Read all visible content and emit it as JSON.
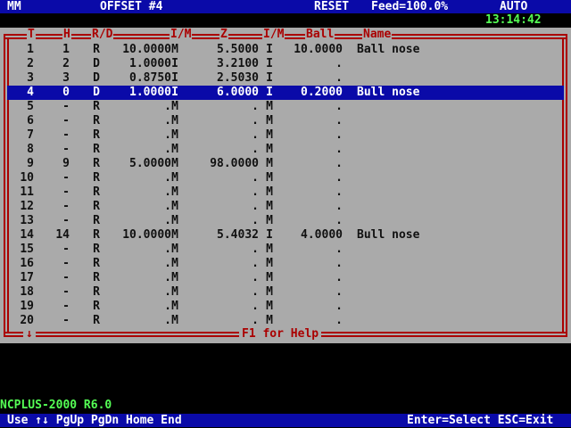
{
  "topbar": {
    "units": "MM",
    "title": "OFFSET #4",
    "state": "RESET",
    "feed": "Feed=100.0%",
    "mode": "AUTO"
  },
  "clock": "13:14:42",
  "table": {
    "headers": {
      "t": "T",
      "h": "H",
      "rd": "R/D",
      "im1": "I/M",
      "z": "Z",
      "im2": "I/M",
      "ball": "Ball",
      "name": "Name"
    },
    "scroll_arrow": "↓",
    "help_label": "F1 for Help",
    "rows": [
      {
        "t": "1",
        "h": "1",
        "rd": "R",
        "dia": "10.0000",
        "im1": "M",
        "z": "5.5000",
        "im2": "I",
        "ball": "10.0000",
        "name": "Ball nose"
      },
      {
        "t": "2",
        "h": "2",
        "rd": "D",
        "dia": "1.0000",
        "im1": "I",
        "z": "3.2100",
        "im2": "I",
        "ball": ".",
        "name": ""
      },
      {
        "t": "3",
        "h": "3",
        "rd": "D",
        "dia": "0.8750",
        "im1": "I",
        "z": "2.5030",
        "im2": "I",
        "ball": ".",
        "name": ""
      },
      {
        "t": "4",
        "h": "0",
        "rd": "D",
        "dia": "1.0000",
        "im1": "I",
        "z": "6.0000",
        "im2": "I",
        "ball": "0.2000",
        "name": "Bull nose"
      },
      {
        "t": "5",
        "h": "-",
        "rd": "R",
        "dia": ".",
        "im1": "M",
        "z": ".",
        "im2": "M",
        "ball": ".",
        "name": ""
      },
      {
        "t": "6",
        "h": "-",
        "rd": "R",
        "dia": ".",
        "im1": "M",
        "z": ".",
        "im2": "M",
        "ball": ".",
        "name": ""
      },
      {
        "t": "7",
        "h": "-",
        "rd": "R",
        "dia": ".",
        "im1": "M",
        "z": ".",
        "im2": "M",
        "ball": ".",
        "name": ""
      },
      {
        "t": "8",
        "h": "-",
        "rd": "R",
        "dia": ".",
        "im1": "M",
        "z": ".",
        "im2": "M",
        "ball": ".",
        "name": ""
      },
      {
        "t": "9",
        "h": "9",
        "rd": "R",
        "dia": "5.0000",
        "im1": "M",
        "z": "98.0000",
        "im2": "M",
        "ball": ".",
        "name": ""
      },
      {
        "t": "10",
        "h": "-",
        "rd": "R",
        "dia": ".",
        "im1": "M",
        "z": ".",
        "im2": "M",
        "ball": ".",
        "name": ""
      },
      {
        "t": "11",
        "h": "-",
        "rd": "R",
        "dia": ".",
        "im1": "M",
        "z": ".",
        "im2": "M",
        "ball": ".",
        "name": ""
      },
      {
        "t": "12",
        "h": "-",
        "rd": "R",
        "dia": ".",
        "im1": "M",
        "z": ".",
        "im2": "M",
        "ball": ".",
        "name": ""
      },
      {
        "t": "13",
        "h": "-",
        "rd": "R",
        "dia": ".",
        "im1": "M",
        "z": ".",
        "im2": "M",
        "ball": ".",
        "name": ""
      },
      {
        "t": "14",
        "h": "14",
        "rd": "R",
        "dia": "10.0000",
        "im1": "M",
        "z": "5.4032",
        "im2": "I",
        "ball": "4.0000",
        "name": "Bull nose"
      },
      {
        "t": "15",
        "h": "-",
        "rd": "R",
        "dia": ".",
        "im1": "M",
        "z": ".",
        "im2": "M",
        "ball": ".",
        "name": ""
      },
      {
        "t": "16",
        "h": "-",
        "rd": "R",
        "dia": ".",
        "im1": "M",
        "z": ".",
        "im2": "M",
        "ball": ".",
        "name": ""
      },
      {
        "t": "17",
        "h": "-",
        "rd": "R",
        "dia": ".",
        "im1": "M",
        "z": ".",
        "im2": "M",
        "ball": ".",
        "name": ""
      },
      {
        "t": "18",
        "h": "-",
        "rd": "R",
        "dia": ".",
        "im1": "M",
        "z": ".",
        "im2": "M",
        "ball": ".",
        "name": ""
      },
      {
        "t": "19",
        "h": "-",
        "rd": "R",
        "dia": ".",
        "im1": "M",
        "z": ".",
        "im2": "M",
        "ball": ".",
        "name": ""
      },
      {
        "t": "20",
        "h": "-",
        "rd": "R",
        "dia": ".",
        "im1": "M",
        "z": ".",
        "im2": "M",
        "ball": ".",
        "name": ""
      }
    ],
    "selected_row": 3
  },
  "version": "NCPLUS-2000 R6.0",
  "bottombar": {
    "nav_hint": "Use ↑↓ PgUp PgDn Home End",
    "action_hint": "Enter=Select ESC=Exit"
  },
  "colors": {
    "bar_bg": "#0a0aa8",
    "panel_bg": "#aaaaaa",
    "frame": "#aa0000",
    "status_text": "#55ff55"
  }
}
